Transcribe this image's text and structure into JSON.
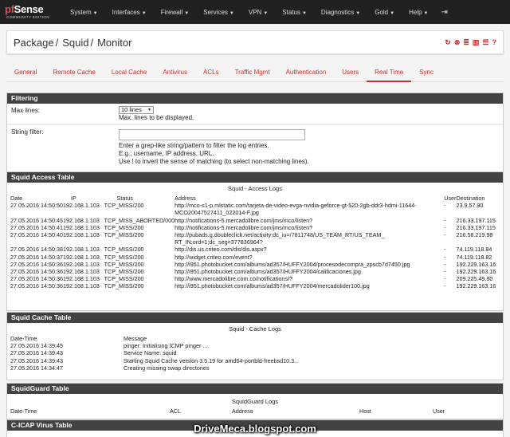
{
  "navbar": {
    "logo_main": "Sense",
    "logo_prefix": "pf",
    "logo_sub": "COMMUNITY EDITION",
    "items": [
      "System",
      "Interfaces",
      "Firewall",
      "Services",
      "VPN",
      "Status",
      "Diagnostics",
      "Gold",
      "Help"
    ],
    "exit_icon": "sign-out-icon"
  },
  "breadcrumb": [
    "Package",
    "Squid",
    "Monitor"
  ],
  "tabs": [
    "General",
    "Remote Cache",
    "Local Cache",
    "Antivirus",
    "ACLs",
    "Traffic Mgmt",
    "Authentication",
    "Users",
    "Real Time",
    "Sync"
  ],
  "active_tab": "Real Time",
  "filtering": {
    "title": "Filtering",
    "max_lines_label": "Max lines:",
    "max_lines_value": "10 lines",
    "max_lines_help": "Max. lines to be displayed.",
    "string_filter_label": "String filter:",
    "string_filter_value": "",
    "help1": "Enter a grep-like string/pattern to filter the log entries.",
    "help2": "E.g.: username, IP address, URL.",
    "help3": "Use ! to invert the sense of matching (to select non-matching lines)."
  },
  "access": {
    "title": "Squid Access Table",
    "caption": "Squid - Access Logs",
    "headers": [
      "Date",
      "IP",
      "Status",
      "Address",
      "User",
      "Destination"
    ],
    "rows": [
      [
        "27.05.2016 14:50:50",
        "192.168.1.103",
        "TCP_MISS/200",
        "http://mco-s1-p.mlstatic.com/tarjeta-de-video-evga-nvidia-geforce-gt-520-2gb-ddr3-hdmi-11644-",
        "-",
        "23.9.57.90"
      ],
      [
        "",
        "",
        "",
        "MCO20047527411_022014-F.jpg",
        "",
        ""
      ],
      [
        "27.05.2016 14:50:45",
        "192.168.1.103",
        "TCP_MISS_ABORTED/000",
        "http://notifications-5.mercadolibre.com/jms/mco/listen?",
        "-",
        "216.33.197.115"
      ],
      [
        "27.05.2016 14:50:41",
        "192.168.1.103",
        "TCP_MISS/200",
        "http://notifications-5.mercadolibre.com/jms/mco/listen?",
        "-",
        "216.33.197.115"
      ],
      [
        "27.05.2016 14:50:40",
        "192.168.1.103",
        "TCP_MISS/200",
        "http://pubads.g.doubleclick.net/activity;dc_iu=/7811748/US_TEAM_RT/US_TEAM_",
        "-",
        "216.58.219.98"
      ],
      [
        "",
        "",
        "",
        "RT_IN;ord=1;dc_seg=377836964?",
        "",
        ""
      ],
      [
        "27.05.2016 14:50:38",
        "192.168.1.103",
        "TCP_MISS/200",
        "http://dis.us.criteo.com/dis/dis.aspx?",
        "-",
        "74.119.118.84"
      ],
      [
        "27.05.2016 14:50:37",
        "192.168.1.103",
        "TCP_MISS/200",
        "http://widget.criteo.com/event?",
        "-",
        "74.119.118.82"
      ],
      [
        "27.05.2016 14:50:36",
        "192.168.1.103",
        "TCP_MISS/200",
        "http://i951.photobucket.com/albums/ad357/HUFFY2004/procesodecompra_zpscb7d7450.jpg",
        "-",
        "192.229.163.16"
      ],
      [
        "27.05.2016 14:50:36",
        "192.168.1.103",
        "TCP_MISS/200",
        "http://i951.photobucket.com/albums/ad357/HUFFY2004/calificaciones.jpg",
        "-",
        "192.229.163.16"
      ],
      [
        "27.05.2016 14:50:36",
        "192.168.1.103",
        "TCP_MISS/200",
        "http://www.mercadolibre.com.co/notifications/?",
        "-",
        "209.225.49.80"
      ],
      [
        "27.05.2016 14:50:36",
        "192.168.1.103",
        "TCP_MISS/200",
        "http://i951.photobucket.com/albums/ad357/HUFFY2004/mercadolider100.jpg",
        "-",
        "192.229.163.16"
      ]
    ]
  },
  "cache": {
    "title": "Squid Cache Table",
    "caption": "Squid - Cache Logs",
    "headers": [
      "Date-Time",
      "Message"
    ],
    "rows": [
      [
        "27.05.2016 14:39:45",
        "pinger: Initialising ICMP pinger ..."
      ],
      [
        "27.05.2016 14:39:43",
        "Service Name: squid"
      ],
      [
        "27.05.2016 14:39:43",
        "Starting Squid Cache version 3.5.19 for amd64-portbld-freebsd10.3..."
      ],
      [
        "27.05.2016 14:34:47",
        "Creating missing swap directories"
      ]
    ]
  },
  "guard": {
    "title": "SquidGuard Table",
    "caption": "SquidGuard Logs",
    "headers": [
      "Date-Time",
      "ACL",
      "Address",
      "Host",
      "User"
    ]
  },
  "cicap": {
    "title": "C-ICAP Virus Table"
  },
  "watermark": "DriveMeca.blogspot.com"
}
